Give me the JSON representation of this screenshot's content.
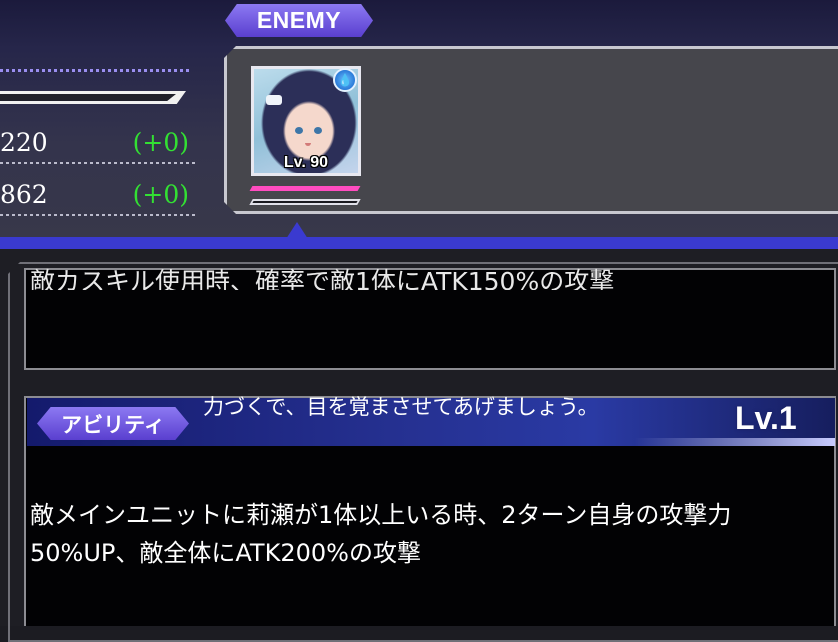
{
  "header": {
    "enemy_label": "ENEMY"
  },
  "stats": [
    {
      "value": "220",
      "diff": "(+0)"
    },
    {
      "value": "862",
      "diff": "(+0)"
    }
  ],
  "enemy": {
    "level": "Lv. 90",
    "element_icon": "water-drop-icon"
  },
  "skill_box": {
    "text": "敵カスキル使用時、確率で敵1体にATK150%の攻撃"
  },
  "ability": {
    "tag": "アビリティ",
    "quote": "力づくで、目を覚まさせてあげましょう。",
    "level": "Lv.1",
    "description": "敵メインユニットに莉瀬が1体以上いる時、2ターン自身の攻撃力50%UP、敵全体にATK200%の攻撃"
  },
  "colors": {
    "accent_purple": "#7a62e4",
    "diff_green": "#33e033",
    "hp_pink": "#ff4cc0",
    "band_blue": "#3a3ad0"
  }
}
